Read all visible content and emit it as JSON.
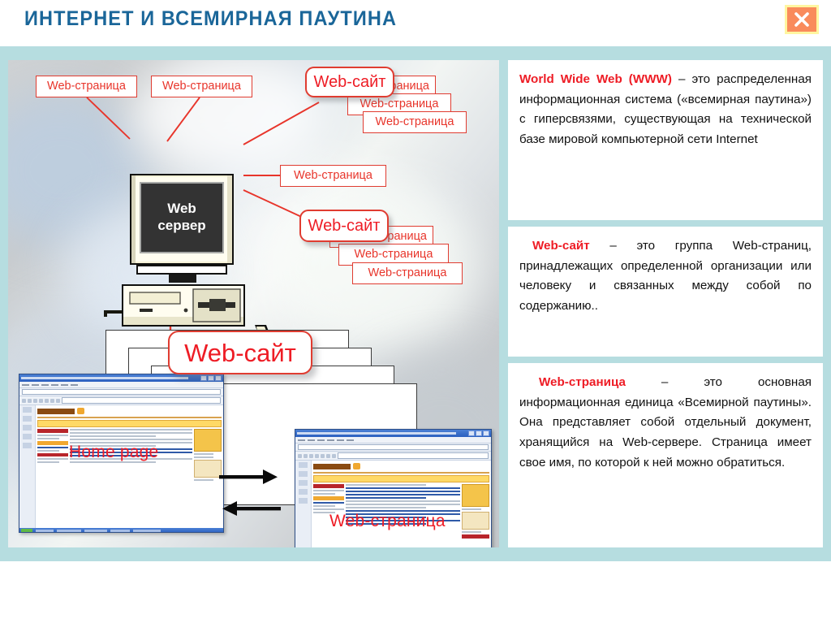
{
  "header": {
    "title": "ИНТЕРНЕТ И ВСЕМИРНАЯ ПАУТИНА",
    "close_label": "×",
    "close_icon": "close-x-icon",
    "title_color": "#1a6699",
    "close_bg": "#f98b5c",
    "close_border": "#fff6a0"
  },
  "theme": {
    "frame_color": "#b6dde0",
    "accent_red": "#ee1c25",
    "label_border": "#e03c31",
    "text_color": "#111111"
  },
  "diagram": {
    "server": {
      "line1": "Web",
      "line2": "сервер"
    },
    "labels": {
      "page_top_left": "Web-страница",
      "page_top_mid": "Web-страница",
      "site_top": "Web-сайт",
      "page_stack_a1": "Web-страница",
      "page_stack_a2": "Web-страница",
      "page_stack_a3": "Web-страница",
      "page_right_mid": "Web-страница",
      "site_mid": "Web-сайт",
      "page_stack_b1": "Web-страница",
      "page_stack_b2": "Web-страница",
      "page_stack_b3": "Web-страница",
      "site_big": "Web-сайт"
    },
    "thumbnails": {
      "home_page": "Home page",
      "web_page": "Web-страница"
    },
    "arrows": [
      "arrow-right",
      "arrow-left"
    ]
  },
  "definitions": [
    {
      "term": "World Wide Web (WWW)",
      "body": " – это распределенная информационная система («всемирная паутина») с гиперсвязями, существующая на технической базе мировой компьютерной сети Internet"
    },
    {
      "term": "Web-сайт",
      "body": " – это группа Web-страниц, принадлежащих определенной организации или человеку и связанных между собой по содержанию.."
    },
    {
      "term": "Web-страница",
      "body": " – это основная информационная единица «Всемирной паутины». Она представляет собой отдельный документ, хранящийся на Web-сервере. Страница имеет свое имя, по которой к ней можно обратиться."
    }
  ]
}
